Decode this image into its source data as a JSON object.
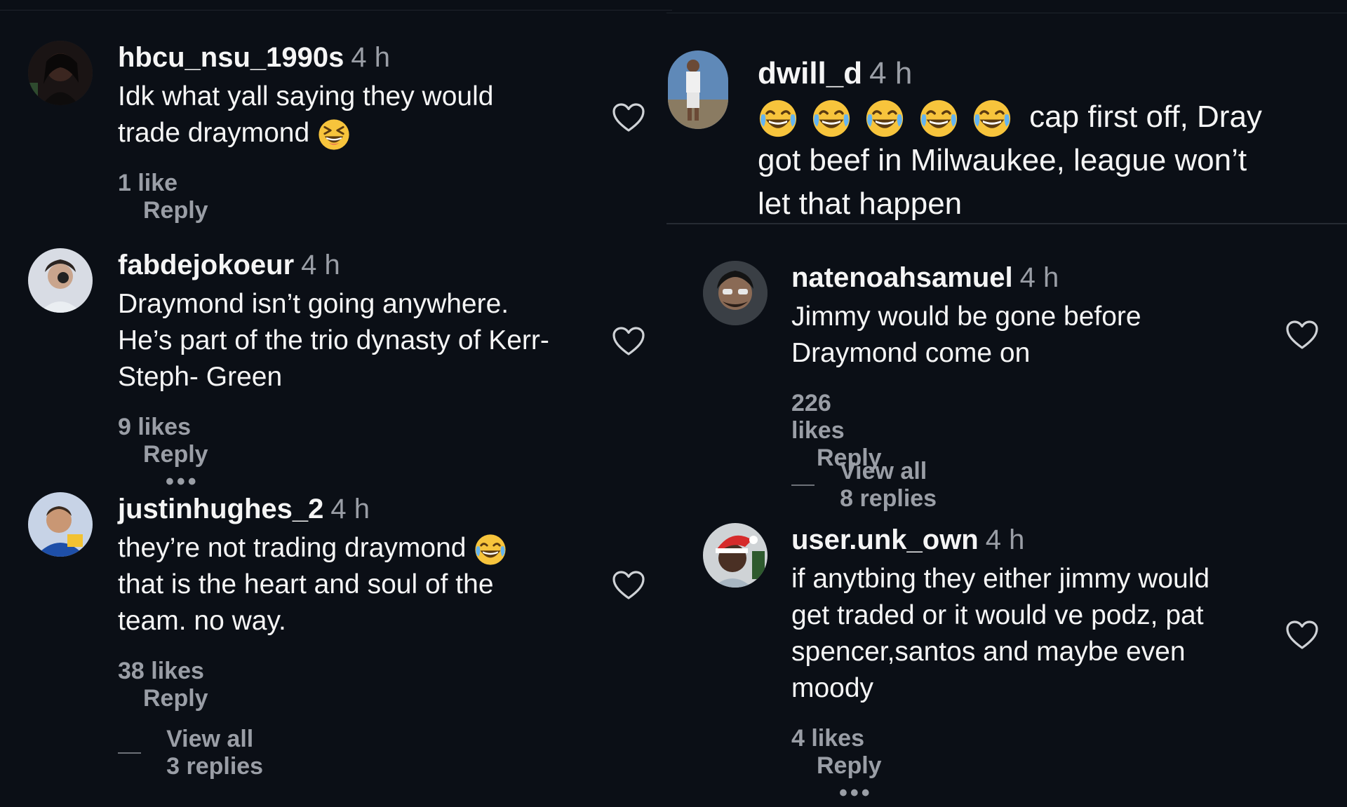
{
  "left": {
    "comments": [
      {
        "username": "hbcu_nsu_1990s",
        "time": "4 h",
        "lines": [
          "Idk what yall saying they would",
          "trade draymond"
        ],
        "emoji": "squinting-laugh",
        "likes": "1 like",
        "reply": "Reply"
      },
      {
        "username": "fabdejokoeur",
        "time": "4 h",
        "lines": [
          "Draymond isn’t going anywhere.",
          "He’s part of the trio dynasty of Kerr-",
          "Steph- Green"
        ],
        "likes": "9 likes",
        "reply": "Reply",
        "more": "•••"
      },
      {
        "username": "justinhughes_2",
        "time": "4 h",
        "lines": [
          "they’re not trading draymond",
          "that is the heart and soul of the",
          "team. no way."
        ],
        "emoji": "tears-of-joy",
        "likes": "38 likes",
        "reply": "Reply",
        "view_replies": "View all 3 replies"
      }
    ]
  },
  "right": {
    "top_comment": {
      "username": "dwill_d",
      "time": "4 h",
      "emoji_line_text": "cap first off, Dray",
      "emoji_count": "5",
      "lines": [
        "got beef in Milwaukee, league won’t",
        "let that happen"
      ]
    },
    "replies": [
      {
        "username": "natenoahsamuel",
        "time": "4 h",
        "lines": [
          "Jimmy would be gone before",
          "Draymond come on"
        ],
        "likes": "226 likes",
        "reply": "Reply",
        "view_replies": "View all 8 replies"
      },
      {
        "username": "user.unk_own",
        "time": "4 h",
        "lines": [
          "if anytbing they either jimmy would",
          "get traded or it would ve podz, pat",
          "spencer,santos and maybe even",
          "moody"
        ],
        "likes": "4 likes",
        "reply": "Reply",
        "more": "•••"
      }
    ]
  },
  "icons": {
    "heart": "heart-outline-icon",
    "emoji_laugh": "tears-of-joy-emoji",
    "emoji_squint": "squinting-laugh-emoji"
  },
  "colors": {
    "background": "#0b0f16",
    "text": "#f5f5f5",
    "muted": "#9a9ea6",
    "emoji": "#f7c43c"
  }
}
